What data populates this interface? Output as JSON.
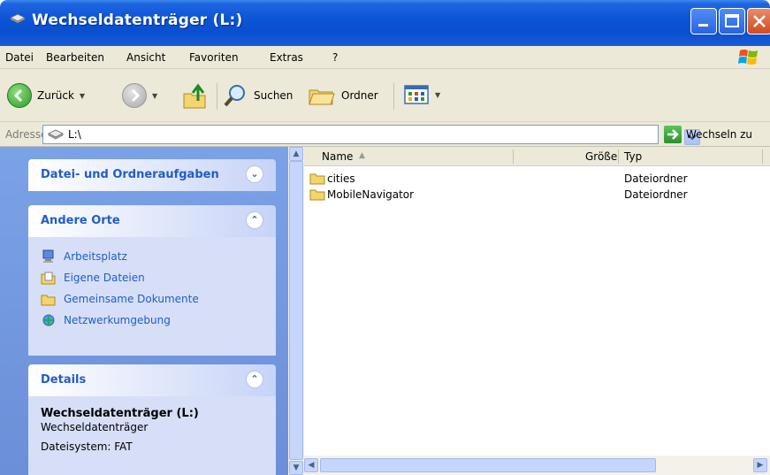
{
  "window": {
    "title": "Wechseldatenträger (L:)",
    "icon": "drive-icon"
  },
  "menu": {
    "items": [
      "Datei",
      "Bearbeiten",
      "Ansicht",
      "Favoriten",
      "Extras",
      "?"
    ]
  },
  "toolbar": {
    "back_label": "Zurück",
    "search_label": "Suchen",
    "folders_label": "Ordner"
  },
  "address": {
    "label": "Adresse",
    "value": "L:\\",
    "go_label": "Wechseln zu"
  },
  "tasks": {
    "file_tasks_title": "Datei- und Ordneraufgaben",
    "other_places_title": "Andere Orte",
    "other_places": [
      {
        "label": "Arbeitsplatz",
        "icon": "computer-icon"
      },
      {
        "label": "Eigene Dateien",
        "icon": "documents-icon"
      },
      {
        "label": "Gemeinsame Dokumente",
        "icon": "folder-icon"
      },
      {
        "label": "Netzwerkumgebung",
        "icon": "network-icon"
      }
    ],
    "details_title": "Details",
    "details_name": "Wechseldatenträger (L:)",
    "details_type": "Wechseldatenträger",
    "details_fs": "Dateisystem: FAT"
  },
  "list": {
    "columns": {
      "name": "Name",
      "size": "Größe",
      "type": "Typ"
    },
    "rows": [
      {
        "name": "cities",
        "type": "Dateiordner"
      },
      {
        "name": "MobileNavigator",
        "type": "Dateiordner"
      }
    ]
  },
  "colors": {
    "titlebar": "#0b55d8",
    "taskpane": "#6b8fd8",
    "link": "#215dc6"
  }
}
